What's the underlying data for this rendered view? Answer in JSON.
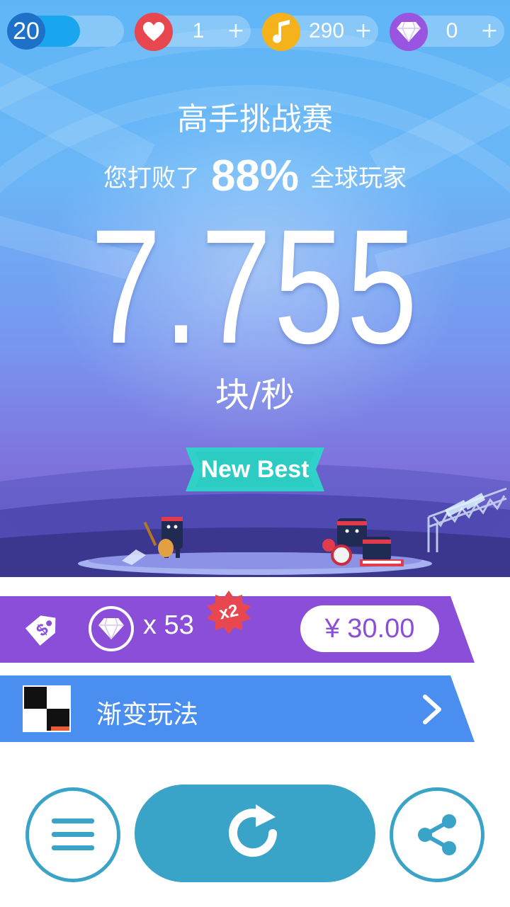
{
  "status_bar": {
    "level": "20",
    "level_progress": 0.62,
    "lives": {
      "icon": "heart-icon",
      "value": "1",
      "plus": "+"
    },
    "notes": {
      "icon": "music-note-icon",
      "value": "290",
      "plus": "+"
    },
    "gems": {
      "icon": "diamond-icon",
      "value": "0",
      "plus": "+"
    }
  },
  "result": {
    "mode_title": "高手挑战赛",
    "beat_prefix": "您打败了",
    "beat_percent": "88%",
    "beat_suffix": "全球玩家",
    "score": "7.755",
    "unit": "块/秒",
    "badge": "New Best"
  },
  "offer": {
    "tag_icon": "price-tag-icon",
    "gem_icon": "diamond-icon",
    "gem_count": "x 53",
    "multiplier": "x2",
    "price": "¥ 30.00"
  },
  "mode_link": {
    "icon": "piano-tile-icon",
    "label": "渐变玩法",
    "chevron": "chevron-right-icon"
  },
  "actions": {
    "menu_icon": "menu-icon",
    "retry_icon": "retry-icon",
    "share_icon": "share-icon"
  },
  "colors": {
    "level_badge": "#1e71c9",
    "level_fill": "#1aa6ef",
    "heart": "#e8474f",
    "note": "#f5b21b",
    "gem": "#9a55e0",
    "offer_band": "#8a4ed8",
    "mode_band": "#4a8ff0",
    "button": "#3aa3c8",
    "ribbon": "#2fd1c8"
  }
}
